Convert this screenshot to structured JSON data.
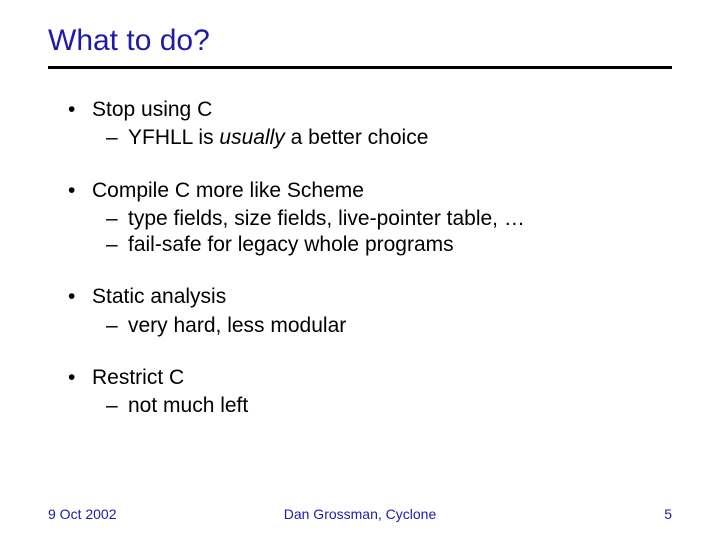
{
  "title": "What to do?",
  "bullets": [
    {
      "text": "Stop using C",
      "sub": [
        {
          "pre": "YFHLL is ",
          "em": "usually",
          "post": " a better choice"
        }
      ]
    },
    {
      "text": "Compile C more like Scheme",
      "sub": [
        {
          "pre": "type fields, size fields, live-pointer table, …",
          "em": "",
          "post": ""
        },
        {
          "pre": "fail-safe for legacy whole programs",
          "em": "",
          "post": ""
        }
      ]
    },
    {
      "text": "Static analysis",
      "sub": [
        {
          "pre": "very hard, less modular",
          "em": "",
          "post": ""
        }
      ]
    },
    {
      "text": "Restrict C",
      "sub": [
        {
          "pre": "not much left",
          "em": "",
          "post": ""
        }
      ]
    }
  ],
  "footer": {
    "date": "9 Oct 2002",
    "author": "Dan Grossman, Cyclone",
    "page": "5"
  }
}
